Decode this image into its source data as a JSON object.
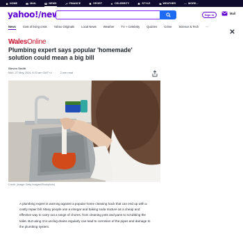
{
  "topbar": {
    "items": [
      {
        "label": "HOME",
        "icon": "home-icon"
      },
      {
        "label": "MAIL",
        "icon": "mail-icon"
      },
      {
        "label": "NEWS",
        "icon": "news-icon",
        "active": true
      },
      {
        "label": "FINANCE",
        "icon": "finance-icon"
      },
      {
        "label": "SPORT",
        "icon": "sport-icon"
      },
      {
        "label": "CELEBRITY",
        "icon": "celebrity-icon"
      },
      {
        "label": "STYLE",
        "icon": "style-icon"
      },
      {
        "label": "WEATHER",
        "icon": "weather-icon"
      },
      {
        "label": "MORE...",
        "icon": "more-icon"
      }
    ]
  },
  "header": {
    "logo_brand": "yahoo!",
    "logo_section": "news",
    "search_placeholder": "",
    "signin_label": "Sign in",
    "mail_label": "Mail"
  },
  "nav": {
    "items": [
      "News",
      "Cost of living crisis",
      "Yahoo Originals",
      "Local News",
      "Weather",
      "TV + Celebrity",
      "Quizzes",
      "Crime",
      "Science & Tech"
    ],
    "more": "..."
  },
  "article": {
    "publisher_a": "Wales",
    "publisher_b": "Online",
    "headline": "Plumbing expert says popular 'homemade' solution could mean a big bill",
    "author": "Steven Smith",
    "date": "Mon, 27 May 2024, 8:22 am GMT+4",
    "read_time": "2-min read",
    "credit": "Credit: (Image: Getty Images/iStockphoto)",
    "body": "A plumbing expert is warning against a popular home cleaning hack that can end up with a costly repair bill. Many people use a vinegar and baking soda mixture as a cheap and effective way to carry out a range of chores, from cleaning pots and pans to scrubbing the toilet. But using it to unclog drains regularly can lead to corrosion of the pipes and damage to the plumbing system."
  },
  "colors": {
    "topbar_bg": "#0f0b2e",
    "brand_purple": "#6001d2",
    "search_blue": "#1d6bf3",
    "publisher_red": "#c8102e"
  }
}
